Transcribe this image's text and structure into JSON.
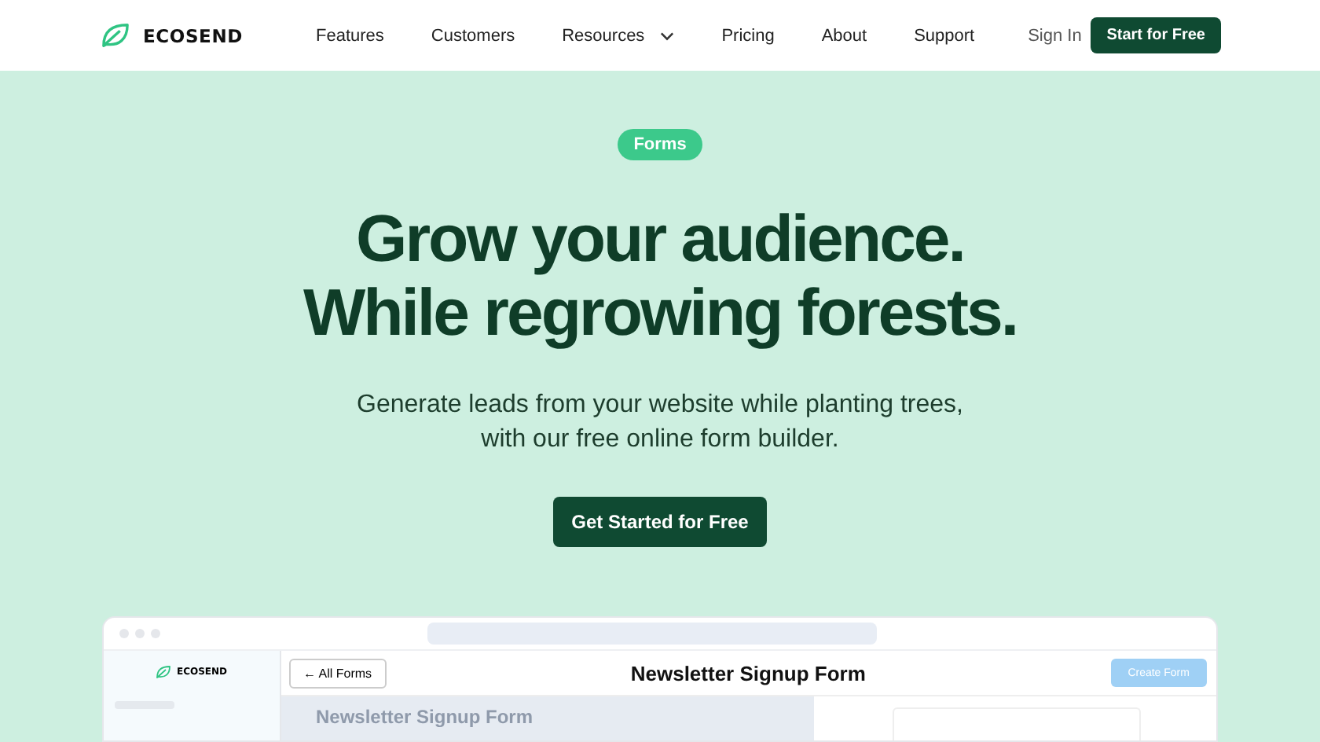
{
  "nav": {
    "brand": "ECOSEND",
    "links": [
      {
        "label": "Features",
        "dropdown": false
      },
      {
        "label": "Customers",
        "dropdown": false
      },
      {
        "label": "Resources",
        "dropdown": true
      },
      {
        "label": "Pricing",
        "dropdown": false
      },
      {
        "label": "About",
        "dropdown": false
      },
      {
        "label": "Support",
        "dropdown": false
      }
    ],
    "sign_in": "Sign In",
    "cta": "Start for Free"
  },
  "hero": {
    "badge": "Forms",
    "headline": [
      "Grow your audience.",
      "While regrowing forests."
    ],
    "subtitle": [
      "Generate leads from your website while planting trees,",
      "with our free online form builder."
    ],
    "cta": "Get Started for Free"
  },
  "preview": {
    "brand": "ECOSEND",
    "back_button": "← All Forms",
    "title": "Newsletter Signup Form",
    "create_button": "Create Form",
    "form_name": "Newsletter Signup Form"
  }
}
